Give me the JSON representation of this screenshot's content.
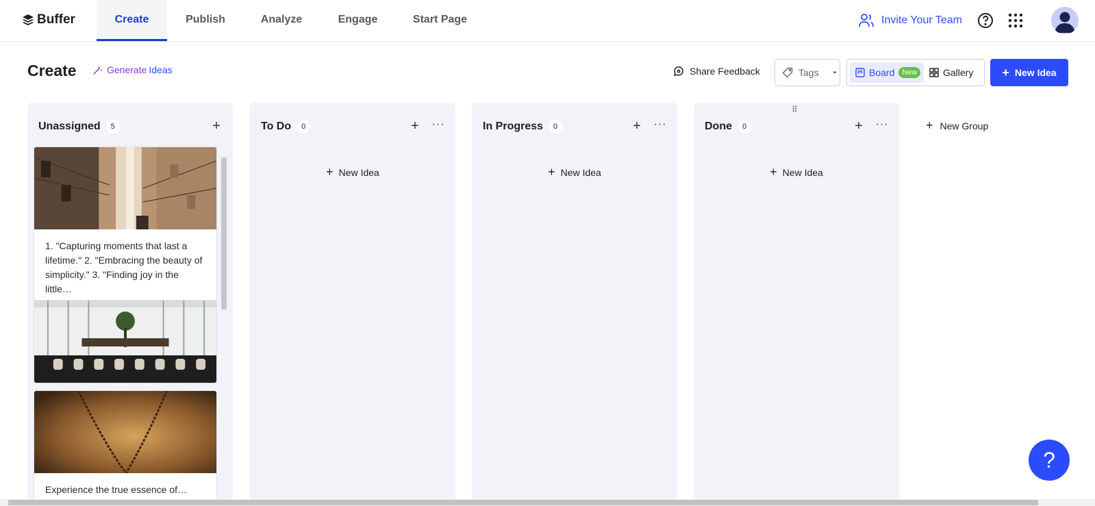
{
  "topbar": {
    "brand": "Buffer",
    "tabs": [
      {
        "label": "Create",
        "active": true
      },
      {
        "label": "Publish"
      },
      {
        "label": "Analyze"
      },
      {
        "label": "Engage"
      },
      {
        "label": "Start Page"
      }
    ],
    "invite_label": "Invite Your Team",
    "icons": [
      "people-icon",
      "help-circle-icon",
      "apps-grid-icon",
      "avatar"
    ]
  },
  "header": {
    "title": "Create",
    "generate_prefix": "Generate",
    "generate_suffix": "Ideas",
    "share_feedback": "Share Feedback",
    "tags_label": "Tags",
    "board_label": "Board",
    "board_badge": "New",
    "gallery_label": "Gallery",
    "new_idea_label": "New Idea"
  },
  "columns": [
    {
      "name": "Unassigned",
      "count": "5"
    },
    {
      "name": "To Do",
      "count": "0",
      "new_idea": "New Idea"
    },
    {
      "name": "In Progress",
      "count": "0",
      "new_idea": "New Idea"
    },
    {
      "name": "Done",
      "count": "0",
      "new_idea": "New Idea"
    }
  ],
  "cards": [
    {
      "text": "1. \"Capturing moments that last a lifetime.\" 2. \"Embracing the beauty of simplicity.\" 3. \"Finding joy in the little…",
      "image": "narrow-city-alley-photo"
    },
    {
      "text": "",
      "image": "rooftop-bar-interior-photo"
    },
    {
      "text": "Experience the true essence of…",
      "image": "gold-chain-necklace-photo"
    }
  ],
  "new_group_label": "New Group",
  "help_fab_label": "?",
  "colors": {
    "accent": "#2c4bff",
    "column_bg": "#f1f3f9",
    "badge_green": "#63c04a",
    "ai_purple": "#8b3bd9"
  }
}
